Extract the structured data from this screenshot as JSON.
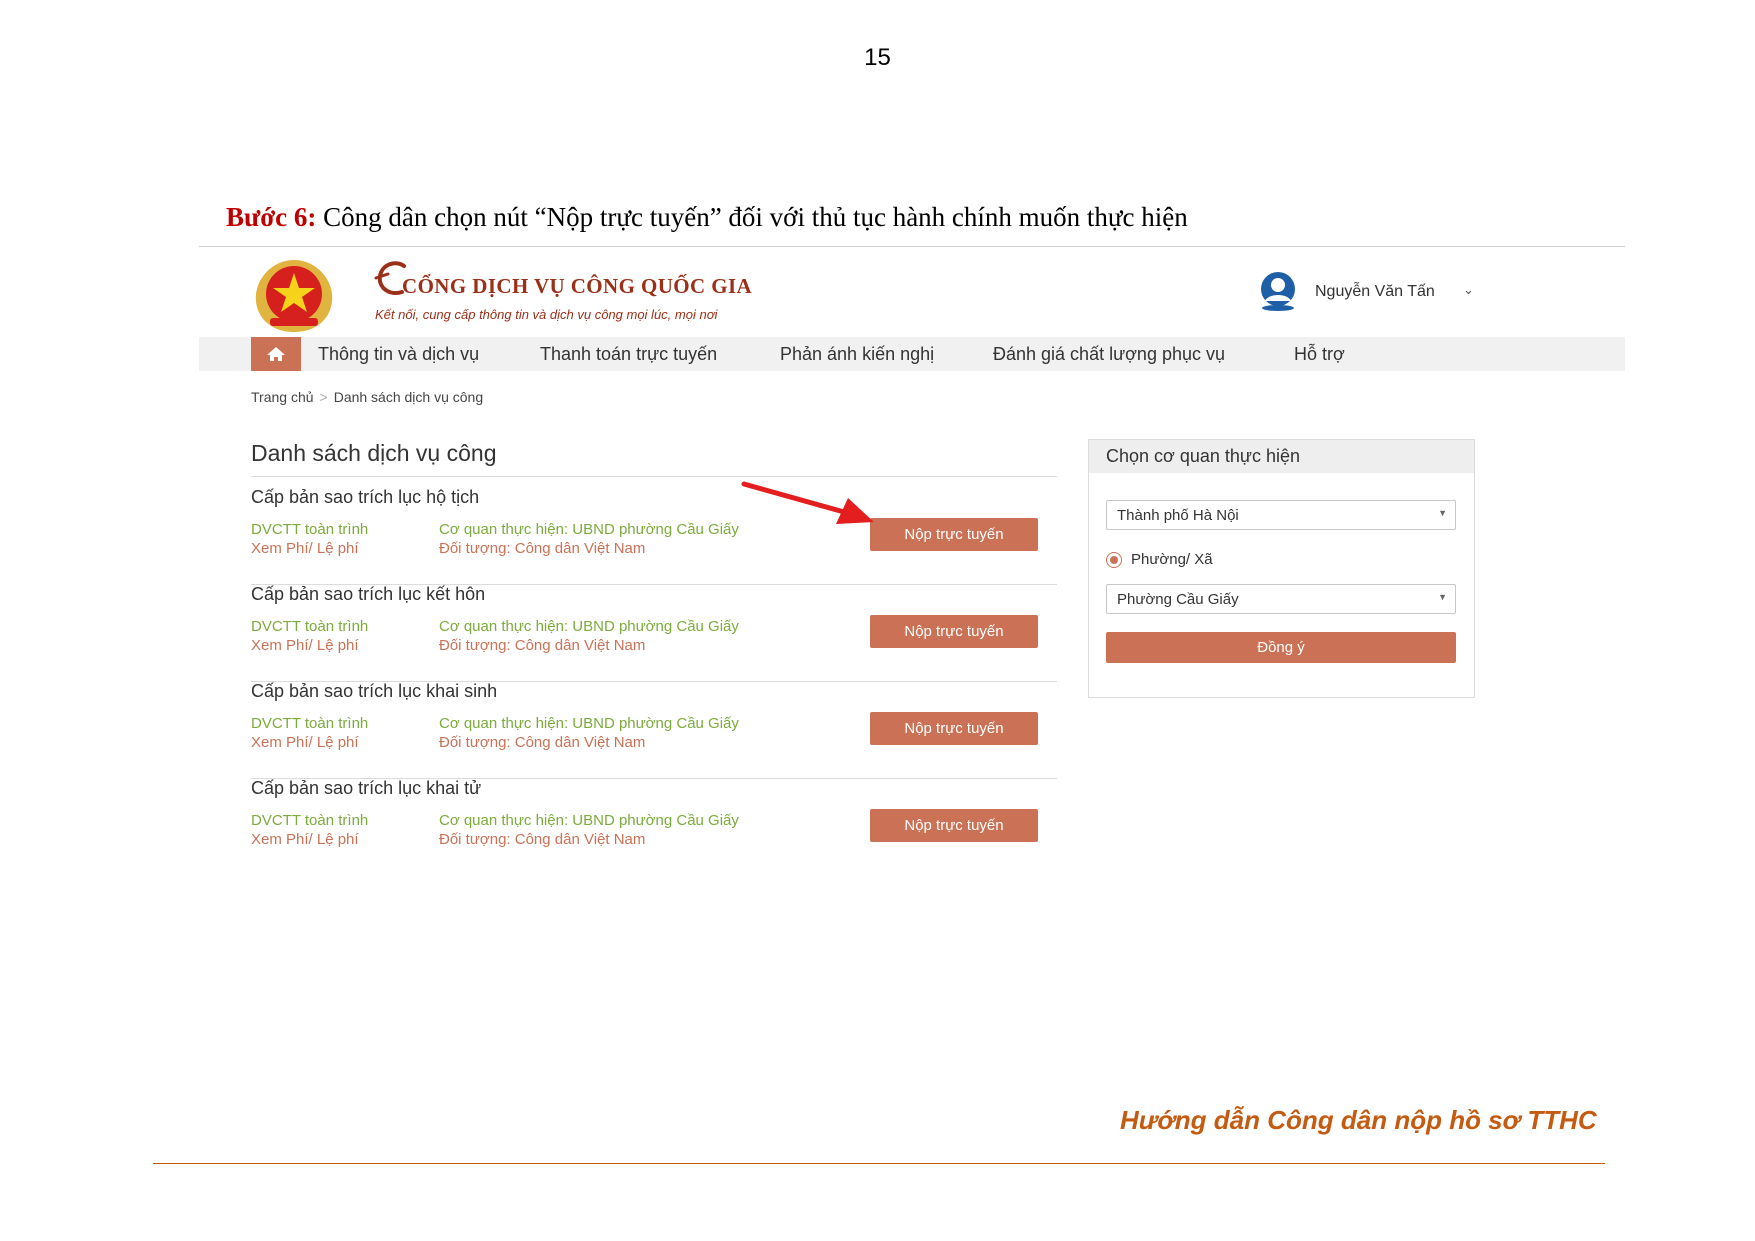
{
  "page": {
    "number": "15"
  },
  "instruction": {
    "step_label": "Bước 6:",
    "text": " Công dân chọn nút “Nộp trực tuyến” đối với thủ tục hành chính muốn thực hiện"
  },
  "portal": {
    "brand_title": "CỔNG DỊCH VỤ CÔNG QUỐC GIA",
    "tagline": "Kết nối, cung cấp thông tin và dịch vụ công mọi lúc, mọi nơi",
    "user_name": "Nguyễn Văn Tấn"
  },
  "nav": {
    "items": [
      {
        "label": "Thông tin và dịch vụ"
      },
      {
        "label": "Thanh toán trực tuyến"
      },
      {
        "label": "Phản ánh kiến nghị"
      },
      {
        "label": "Đánh giá chất lượng phục vụ"
      },
      {
        "label": "Hỗ trợ"
      }
    ]
  },
  "breadcrumb": {
    "home": "Trang chủ",
    "current": "Danh sách dịch vụ công"
  },
  "list": {
    "title": "Danh sách dịch vụ công",
    "services": [
      {
        "name": "Cấp bản sao trích lục hộ tịch",
        "type": "DVCTT toàn trình",
        "fee_link": "Xem Phí/ Lệ phí",
        "agency": "Cơ quan thực hiện: UBND phường Cầu Giấy",
        "target": "Đối tượng: Công dân Việt Nam",
        "button": "Nộp trực tuyến"
      },
      {
        "name": "Cấp bản sao trích lục kết hôn",
        "type": "DVCTT toàn trình",
        "fee_link": "Xem Phí/ Lệ phí",
        "agency": "Cơ quan thực hiện: UBND phường Cầu Giấy",
        "target": "Đối tượng: Công dân Việt Nam",
        "button": "Nộp trực tuyến"
      },
      {
        "name": "Cấp bản sao trích lục khai sinh",
        "type": "DVCTT toàn trình",
        "fee_link": "Xem Phí/ Lệ phí",
        "agency": "Cơ quan thực hiện: UBND phường Cầu Giấy",
        "target": "Đối tượng: Công dân Việt Nam",
        "button": "Nộp trực tuyến"
      },
      {
        "name": "Cấp bản sao trích lục khai tử",
        "type": "DVCTT toàn trình",
        "fee_link": "Xem Phí/ Lệ phí",
        "agency": "Cơ quan thực hiện: UBND phường Cầu Giấy",
        "target": "Đối tượng: Công dân Việt Nam",
        "button": "Nộp trực tuyến"
      }
    ]
  },
  "side_panel": {
    "title": "Chọn cơ quan thực hiện",
    "city_select": "Thành phố Hà Nội",
    "level_radio": "Phường/ Xã",
    "ward_select": "Phường Cầu Giấy",
    "confirm_button": "Đồng ý"
  },
  "footer": {
    "title": "Hướng dẫn Công dân nộp hồ sơ TTHC"
  },
  "colors": {
    "accent": "#cb7256",
    "heading_red": "#c00000",
    "brand": "#9b2f17",
    "green_text": "#7cab3c",
    "footer_orange": "#c55a11"
  },
  "icons": [
    "national-emblem-icon",
    "brand-logo-icon",
    "user-avatar-icon",
    "chevron-down-icon",
    "home-icon",
    "red-arrow-icon",
    "select-caret-icon",
    "radio-icon"
  ]
}
